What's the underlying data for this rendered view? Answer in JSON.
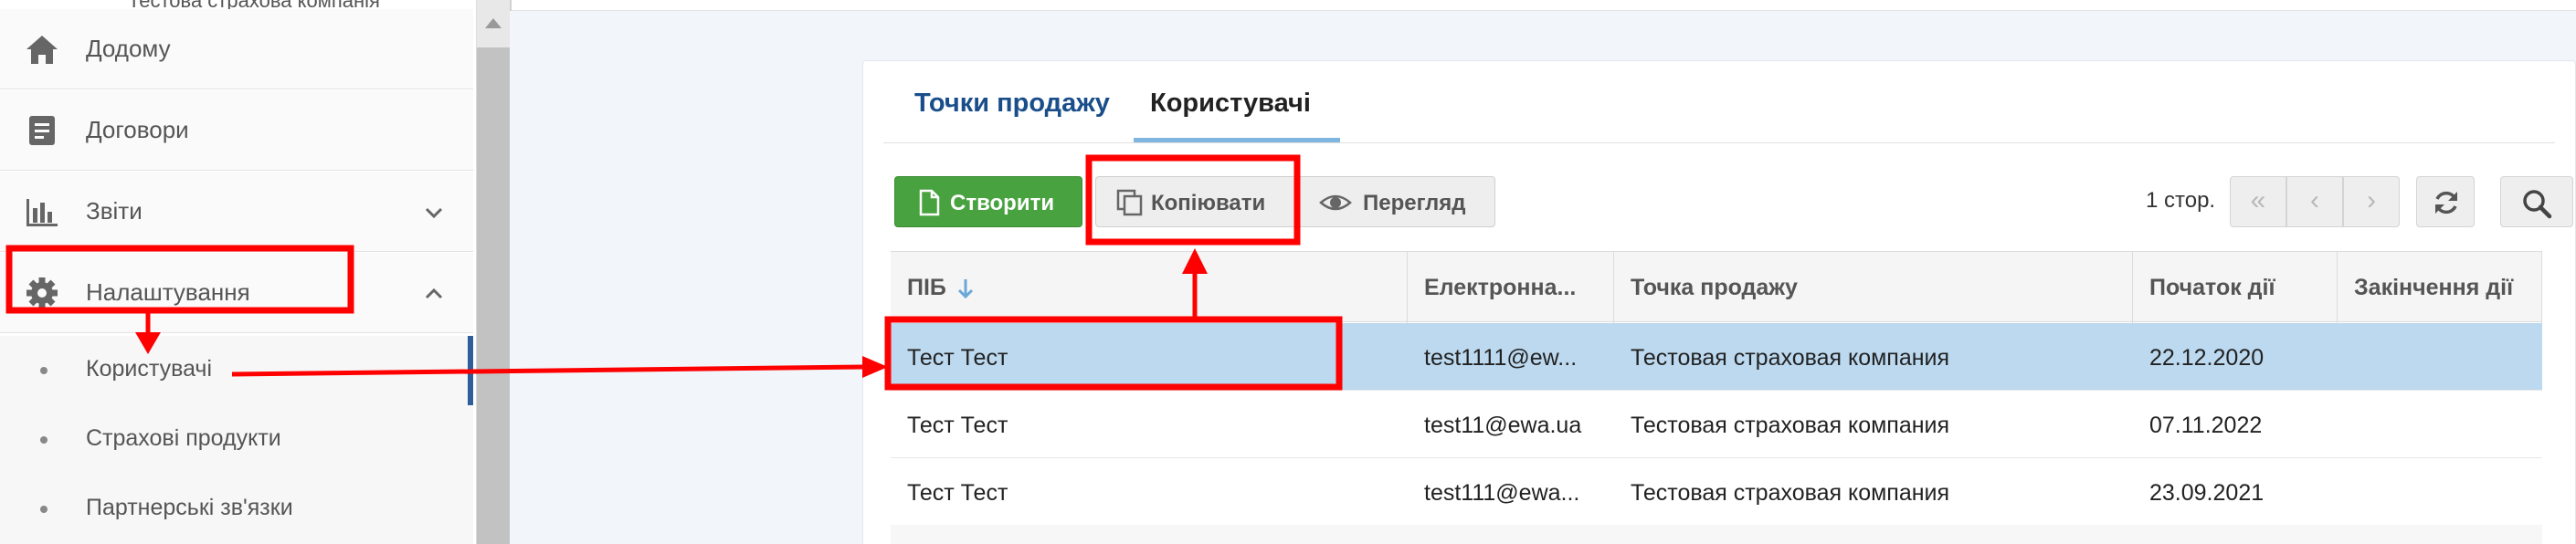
{
  "sidebar": {
    "top_partial_text": "Тестова страхова компанія",
    "items": [
      {
        "label": "Додому",
        "icon": "home-icon"
      },
      {
        "label": "Договори",
        "icon": "document-icon"
      },
      {
        "label": "Звіти",
        "icon": "bar-chart-icon"
      },
      {
        "label": "Налаштування",
        "icon": "gear-icon"
      }
    ],
    "submenu": [
      {
        "label": "Користувачі",
        "active": true
      },
      {
        "label": "Страхові продукти"
      },
      {
        "label": "Партнерські зв'язки"
      }
    ]
  },
  "tabs": [
    {
      "label": "Точки продажу"
    },
    {
      "label": "Користувачі",
      "active": true
    }
  ],
  "toolbar": {
    "create_label": "Створити",
    "copy_label": "Копіювати",
    "view_label": "Перегляд"
  },
  "pager": {
    "label": "1 стор.",
    "first": "«",
    "prev": "‹",
    "next": "›"
  },
  "table": {
    "columns": [
      "ПІБ",
      "Електронна...",
      "Точка продажу",
      "Початок дії",
      "Закінчення дії"
    ],
    "rows": [
      {
        "name": "Тест Тест",
        "email": "test1111@ew...",
        "point": "Тестовая страховая компания",
        "start": "22.12.2020",
        "end": "",
        "selected": true
      },
      {
        "name": "Тест Тест",
        "email": "test11@ewa.ua",
        "point": "Тестовая страховая компания",
        "start": "07.11.2022",
        "end": ""
      },
      {
        "name": "Тест Тест",
        "email": "test111@ewa...",
        "point": "Тестовая страховая компания",
        "start": "23.09.2021",
        "end": ""
      }
    ]
  },
  "colors": {
    "accent_blue": "#1a4e8a",
    "create_green": "#48a23f",
    "selected_row": "#bcd9ef",
    "annotation_red": "#ff0000"
  }
}
